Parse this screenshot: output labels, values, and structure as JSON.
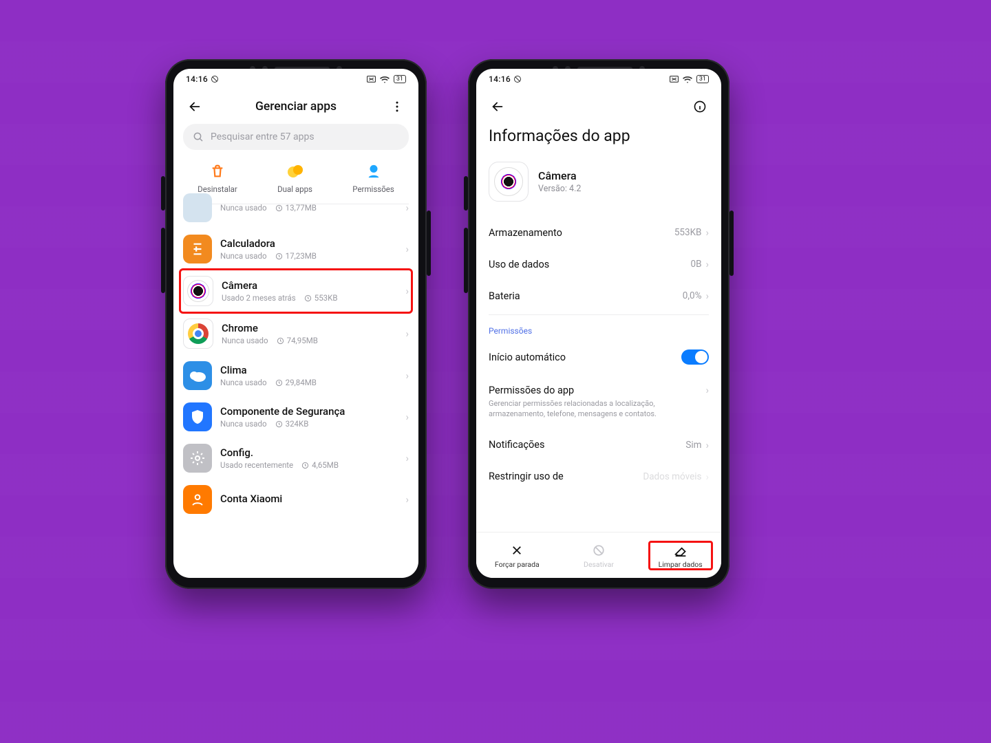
{
  "status": {
    "time": "14:16",
    "battery": "31"
  },
  "left": {
    "title": "Gerenciar apps",
    "search_placeholder": "Pesquisar entre 57 apps",
    "quick_actions": {
      "uninstall": "Desinstalar",
      "dual": "Dual apps",
      "perms": "Permissões"
    },
    "apps": [
      {
        "name": "",
        "usage": "Nunca usado",
        "size": "13,77MB",
        "icon": "unknown"
      },
      {
        "name": "Calculadora",
        "usage": "Nunca usado",
        "size": "17,23MB",
        "icon": "calc"
      },
      {
        "name": "Câmera",
        "usage": "Usado 2 meses atrás",
        "size": "553KB",
        "icon": "cam",
        "highlight": true
      },
      {
        "name": "Chrome",
        "usage": "Nunca usado",
        "size": "74,95MB",
        "icon": "chrome"
      },
      {
        "name": "Clima",
        "usage": "Nunca usado",
        "size": "29,84MB",
        "icon": "weather"
      },
      {
        "name": "Componente de Segurança",
        "usage": "Nunca usado",
        "size": "324KB",
        "icon": "sec"
      },
      {
        "name": "Config.",
        "usage": "Usado recentemente",
        "size": "4,65MB",
        "icon": "conf"
      },
      {
        "name": "Conta Xiaomi",
        "usage": "",
        "size": "",
        "icon": "xiaomi"
      }
    ]
  },
  "right": {
    "title": "Informações do app",
    "app_name": "Câmera",
    "version_label": "Versão: 4.2",
    "kv": {
      "storage_label": "Armazenamento",
      "storage_value": "553KB",
      "data_label": "Uso de dados",
      "data_value": "0B",
      "battery_label": "Bateria",
      "battery_value": "0,0%"
    },
    "perms_section": "Permissões",
    "autostart_label": "Início automático",
    "appperms_label": "Permissões do app",
    "appperms_desc": "Gerenciar permissões relacionadas a localização, armazenamento, telefone, mensagens e contatos.",
    "notif_label": "Notificações",
    "notif_value": "Sim",
    "restrict_label": "Restringir uso de",
    "restrict_value": "Dados móveis",
    "bottom": {
      "force": "Forçar parada",
      "disable": "Desativar",
      "clear": "Limpar dados"
    }
  }
}
